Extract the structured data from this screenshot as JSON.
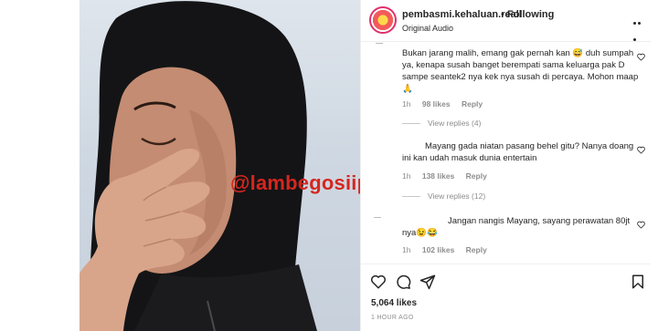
{
  "post": {
    "username": "pembasmi.kehaluan.reall",
    "separator": "•",
    "follow_label": "Following",
    "audio_label": "Original Audio",
    "watermark": "@lambegosiip"
  },
  "comments": [
    {
      "text": "Bukan jarang malih, emang gak pernah kan 😅 duh sumpah ya, kenapa susah banget berempati sama keluarga pak D sampe seantek2 nya kek nya susah di percaya. Mohon maap 🙏",
      "time": "1h",
      "likes": "98 likes",
      "reply_label": "Reply",
      "view_replies": "View replies (4)"
    },
    {
      "text": "Mayang gada niatan pasang behel gitu? Nanya doang ini kan udah masuk dunia entertain",
      "time": "1h",
      "likes": "138 likes",
      "reply_label": "Reply",
      "view_replies": "View replies (12)"
    },
    {
      "text": "Jangan nangis Mayang, sayang perawatan 80jt nya😉😂",
      "time": "1h",
      "likes": "102 likes",
      "reply_label": "Reply"
    }
  ],
  "footer": {
    "likes": "5,064 likes",
    "time": "1 HOUR AGO"
  }
}
